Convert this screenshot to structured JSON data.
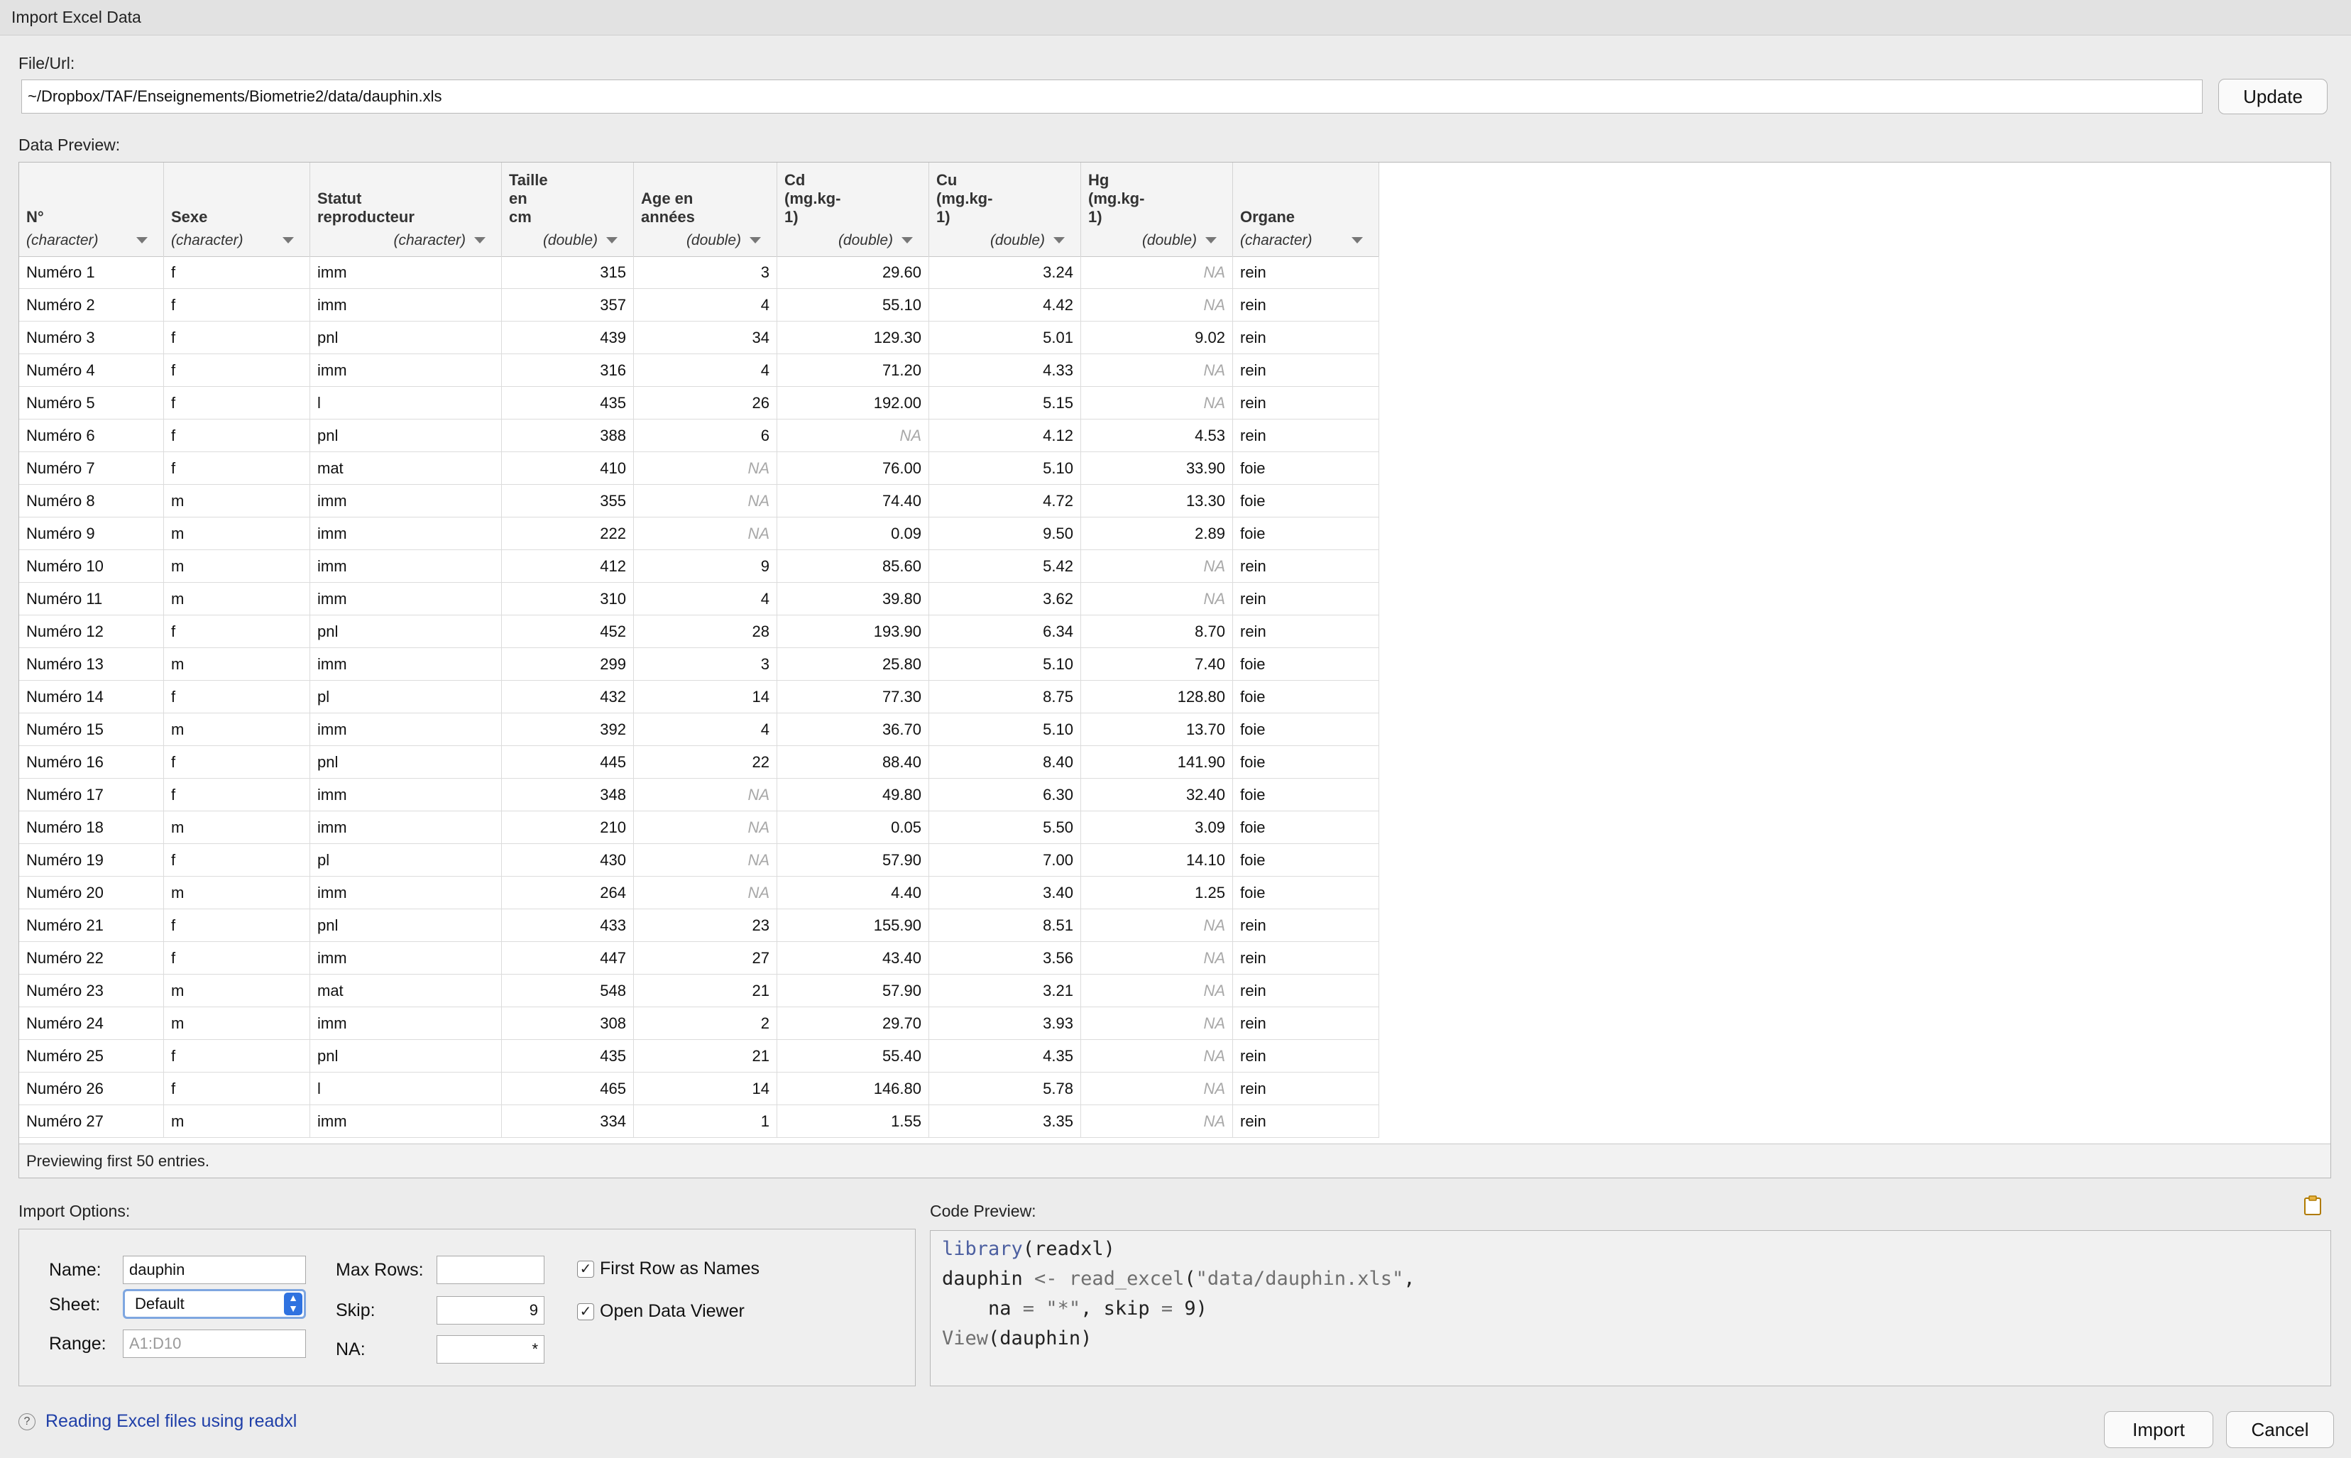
{
  "window": {
    "title": "Import Excel Data"
  },
  "file": {
    "label": "File/Url:",
    "value": "~/Dropbox/TAF/Enseignements/Biometrie2/data/dauphin.xls",
    "update_label": "Update"
  },
  "preview": {
    "label": "Data Preview:",
    "columns": [
      {
        "name": "N°",
        "type": "(character)",
        "align": "left"
      },
      {
        "name": "Sexe",
        "type": "(character)",
        "align": "left"
      },
      {
        "name": "Statut\nreproducteur",
        "type": "(character)",
        "align": "right"
      },
      {
        "name": "Taille\nen\ncm",
        "type": "(double)",
        "align": "right"
      },
      {
        "name": "Age en\nannées",
        "type": "(double)",
        "align": "right"
      },
      {
        "name": "Cd\n(mg.kg-\n1)",
        "type": "(double)",
        "align": "right"
      },
      {
        "name": "Cu\n(mg.kg-\n1)",
        "type": "(double)",
        "align": "right"
      },
      {
        "name": "Hg\n(mg.kg-\n1)",
        "type": "(double)",
        "align": "right"
      },
      {
        "name": "Organe",
        "type": "(character)",
        "align": "left"
      }
    ],
    "rows": [
      [
        "Numéro 1",
        "f",
        "imm",
        "315",
        "3",
        "29.60",
        "3.24",
        "NA",
        "rein"
      ],
      [
        "Numéro 2",
        "f",
        "imm",
        "357",
        "4",
        "55.10",
        "4.42",
        "NA",
        "rein"
      ],
      [
        "Numéro 3",
        "f",
        "pnl",
        "439",
        "34",
        "129.30",
        "5.01",
        "9.02",
        "rein"
      ],
      [
        "Numéro 4",
        "f",
        "imm",
        "316",
        "4",
        "71.20",
        "4.33",
        "NA",
        "rein"
      ],
      [
        "Numéro 5",
        "f",
        "l",
        "435",
        "26",
        "192.00",
        "5.15",
        "NA",
        "rein"
      ],
      [
        "Numéro 6",
        "f",
        "pnl",
        "388",
        "6",
        "NA",
        "4.12",
        "4.53",
        "rein"
      ],
      [
        "Numéro 7",
        "f",
        "mat",
        "410",
        "NA",
        "76.00",
        "5.10",
        "33.90",
        "foie"
      ],
      [
        "Numéro 8",
        "m",
        "imm",
        "355",
        "NA",
        "74.40",
        "4.72",
        "13.30",
        "foie"
      ],
      [
        "Numéro 9",
        "m",
        "imm",
        "222",
        "NA",
        "0.09",
        "9.50",
        "2.89",
        "foie"
      ],
      [
        "Numéro 10",
        "m",
        "imm",
        "412",
        "9",
        "85.60",
        "5.42",
        "NA",
        "rein"
      ],
      [
        "Numéro 11",
        "m",
        "imm",
        "310",
        "4",
        "39.80",
        "3.62",
        "NA",
        "rein"
      ],
      [
        "Numéro 12",
        "f",
        "pnl",
        "452",
        "28",
        "193.90",
        "6.34",
        "8.70",
        "rein"
      ],
      [
        "Numéro 13",
        "m",
        "imm",
        "299",
        "3",
        "25.80",
        "5.10",
        "7.40",
        "foie"
      ],
      [
        "Numéro 14",
        "f",
        "pl",
        "432",
        "14",
        "77.30",
        "8.75",
        "128.80",
        "foie"
      ],
      [
        "Numéro 15",
        "m",
        "imm",
        "392",
        "4",
        "36.70",
        "5.10",
        "13.70",
        "foie"
      ],
      [
        "Numéro 16",
        "f",
        "pnl",
        "445",
        "22",
        "88.40",
        "8.40",
        "141.90",
        "foie"
      ],
      [
        "Numéro 17",
        "f",
        "imm",
        "348",
        "NA",
        "49.80",
        "6.30",
        "32.40",
        "foie"
      ],
      [
        "Numéro 18",
        "m",
        "imm",
        "210",
        "NA",
        "0.05",
        "5.50",
        "3.09",
        "foie"
      ],
      [
        "Numéro 19",
        "f",
        "pl",
        "430",
        "NA",
        "57.90",
        "7.00",
        "14.10",
        "foie"
      ],
      [
        "Numéro 20",
        "m",
        "imm",
        "264",
        "NA",
        "4.40",
        "3.40",
        "1.25",
        "foie"
      ],
      [
        "Numéro 21",
        "f",
        "pnl",
        "433",
        "23",
        "155.90",
        "8.51",
        "NA",
        "rein"
      ],
      [
        "Numéro 22",
        "f",
        "imm",
        "447",
        "27",
        "43.40",
        "3.56",
        "NA",
        "rein"
      ],
      [
        "Numéro 23",
        "m",
        "mat",
        "548",
        "21",
        "57.90",
        "3.21",
        "NA",
        "rein"
      ],
      [
        "Numéro 24",
        "m",
        "imm",
        "308",
        "2",
        "29.70",
        "3.93",
        "NA",
        "rein"
      ],
      [
        "Numéro 25",
        "f",
        "pnl",
        "435",
        "21",
        "55.40",
        "4.35",
        "NA",
        "rein"
      ],
      [
        "Numéro 26",
        "f",
        "l",
        "465",
        "14",
        "146.80",
        "5.78",
        "NA",
        "rein"
      ],
      [
        "Numéro 27",
        "m",
        "imm",
        "334",
        "1",
        "1.55",
        "3.35",
        "NA",
        "rein"
      ]
    ],
    "footer": "Previewing first 50 entries."
  },
  "options": {
    "label": "Import Options:",
    "name_label": "Name:",
    "name_value": "dauphin",
    "sheet_label": "Sheet:",
    "sheet_value": "Default",
    "range_label": "Range:",
    "range_placeholder": "A1:D10",
    "maxrows_label": "Max Rows:",
    "maxrows_value": "",
    "skip_label": "Skip:",
    "skip_value": "9",
    "na_label": "NA:",
    "na_value": "*",
    "first_row_label": "First Row as Names",
    "first_row_checked": true,
    "open_viewer_label": "Open Data Viewer",
    "open_viewer_checked": true
  },
  "code": {
    "label": "Code Preview:",
    "l1_kw": "library",
    "l1_rest": "(readxl)",
    "l2_a": "dauphin ",
    "l2_op": "<- ",
    "l2_fn": "read_excel",
    "l2_b": "(",
    "l2_str": "\"data/dauphin.xls\"",
    "l2_c": ",",
    "l3_a": "    na ",
    "l3_op": "= ",
    "l3_str": "\"*\"",
    "l3_b": ", skip ",
    "l3_op2": "= ",
    "l3_c": "9)",
    "l4_kw": "View",
    "l4_rest": "(dauphin)"
  },
  "help": {
    "link": "Reading Excel files using readxl"
  },
  "actions": {
    "import_label": "Import",
    "cancel_label": "Cancel"
  },
  "colors": {
    "accent": "#2f72e0",
    "link": "#1f3fa8",
    "na_text": "#a8a8a8"
  }
}
